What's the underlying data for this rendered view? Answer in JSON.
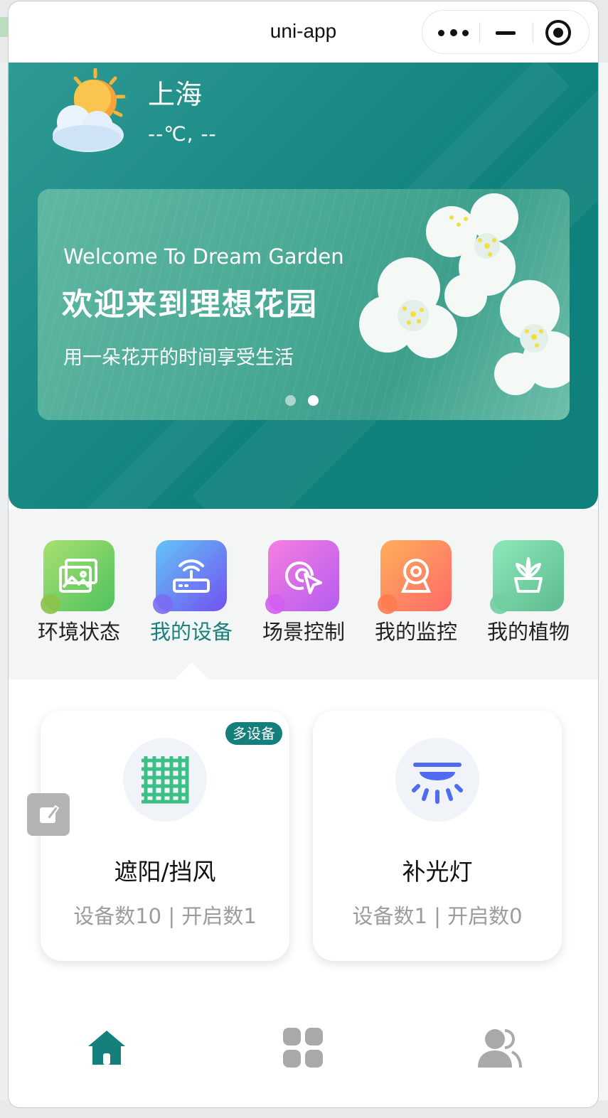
{
  "window": {
    "title": "uni-app"
  },
  "capsule": {
    "more_icon": "more-dots-icon",
    "minimize_icon": "minimize-icon",
    "close_icon": "target-circle-icon"
  },
  "weather": {
    "city": "上海",
    "temperature": "--℃, --",
    "icon": "partly-cloudy-icon"
  },
  "banner": {
    "title_en": "Welcome To Dream Garden",
    "title_cn": "欢迎来到理想花园",
    "subtitle": "用一朵花开的时间享受生活",
    "active_dot": 1,
    "dot_count": 2
  },
  "categories": [
    {
      "label": "环境状态",
      "icon": "landscape-picture-icon",
      "color": "#6cc95e"
    },
    {
      "label": "我的设备",
      "icon": "router-device-icon",
      "color": "#7a6cf2",
      "active": true
    },
    {
      "label": "场景控制",
      "icon": "cursor-target-icon",
      "color": "#d45ef0"
    },
    {
      "label": "我的监控",
      "icon": "webcam-icon",
      "color": "#ff7b6b"
    },
    {
      "label": "我的植物",
      "icon": "potted-plant-icon",
      "color": "#6fcfa1"
    }
  ],
  "devices": [
    {
      "name": "遮阳/挡风",
      "stats": "设备数10 | 开启数1",
      "badge": "多设备",
      "icon": "shade-net-icon",
      "color": "#3cbf86"
    },
    {
      "name": "补光灯",
      "stats": "设备数1 | 开启数0",
      "icon": "ceiling-lamp-icon",
      "color": "#4f6cf0"
    }
  ],
  "tabbar": {
    "items": [
      {
        "icon": "home-icon",
        "active": true
      },
      {
        "icon": "grid-apps-icon",
        "active": false
      },
      {
        "icon": "users-icon",
        "active": false
      }
    ],
    "active_color": "#157f7b",
    "inactive_color": "#a9a9a9"
  },
  "colors": {
    "primary": "#157f7b",
    "text": "#222222",
    "muted": "#9c9c9c"
  }
}
